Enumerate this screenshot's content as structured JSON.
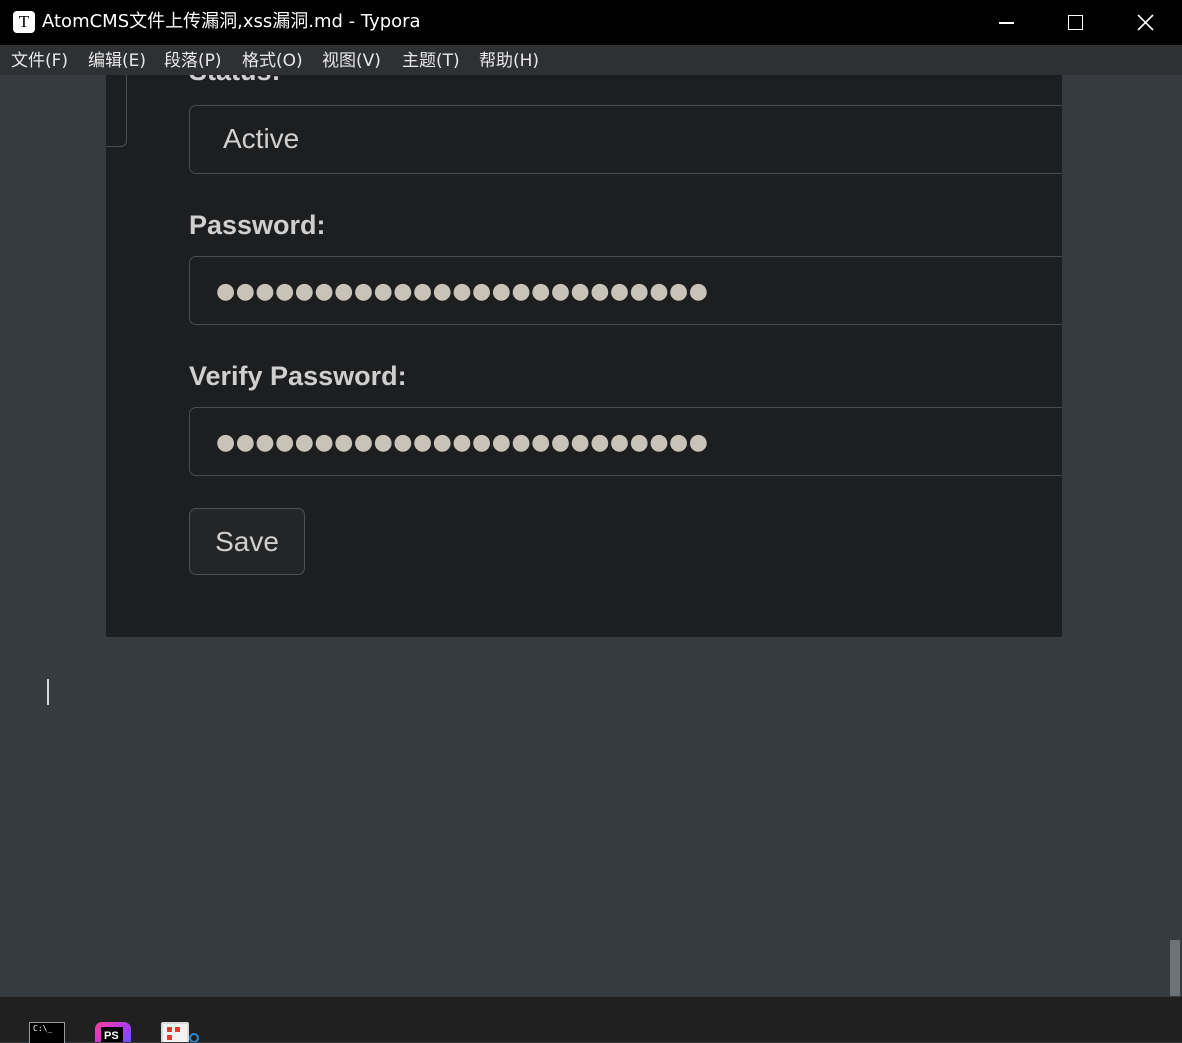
{
  "window": {
    "app_icon_glyph": "T",
    "title": "AtomCMS文件上传漏洞,xss漏洞.md - Typora",
    "controls": [
      "minimize-icon",
      "maximize-icon",
      "close-icon"
    ]
  },
  "menu": {
    "items": [
      {
        "label": "文件(F)"
      },
      {
        "label": "编辑(E)"
      },
      {
        "label": "段落(P)"
      },
      {
        "label": "格式(O)"
      },
      {
        "label": "视图(V)"
      },
      {
        "label": "主题(T)"
      },
      {
        "label": "帮助(H)"
      }
    ]
  },
  "embedded_form": {
    "status_label": "Status:",
    "status_value": "Active",
    "password_label": "Password:",
    "password_value": "●●●●●●●●●●●●●●●●●●●●●●●●●",
    "verify_label": "Verify Password:",
    "verify_value": "●●●●●●●●●●●●●●●●●●●●●●●●●",
    "save_label": "Save"
  },
  "taskbar": {
    "apps": [
      "terminal-icon",
      "phpstorm-icon",
      "screenshot-tool-icon"
    ],
    "terminal_prompt": "C:\\_",
    "phpstorm_text": "PS"
  },
  "colors": {
    "titlebar": "#000000",
    "menubar": "#2e3033",
    "editor_bg": "#363b40",
    "form_bg": "#1d1e20",
    "taskbar": "#202020"
  }
}
